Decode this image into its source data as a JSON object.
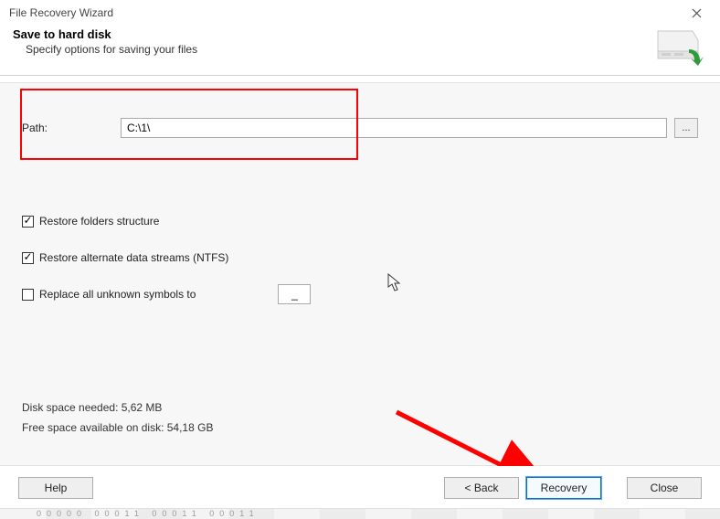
{
  "window": {
    "title": "File Recovery Wizard"
  },
  "header": {
    "heading": "Save to hard disk",
    "subtitle": "Specify options for saving your files"
  },
  "path": {
    "label": "Path:",
    "value": "C:\\1\\",
    "browse_label": "..."
  },
  "options": {
    "restore_folders": {
      "label": "Restore folders structure",
      "checked": true
    },
    "restore_ads": {
      "label": "Restore alternate data streams (NTFS)",
      "checked": true
    },
    "replace_unknown": {
      "label": "Replace all unknown symbols to",
      "checked": false,
      "value": "_"
    }
  },
  "disk": {
    "needed_label": "Disk space needed: 5,62 MB",
    "free_label": "Free space available on disk: 54,18 GB"
  },
  "footer": {
    "help": "Help",
    "back": "< Back",
    "recovery": "Recovery",
    "close": "Close"
  },
  "strip": "00000          00011             00011           00011"
}
